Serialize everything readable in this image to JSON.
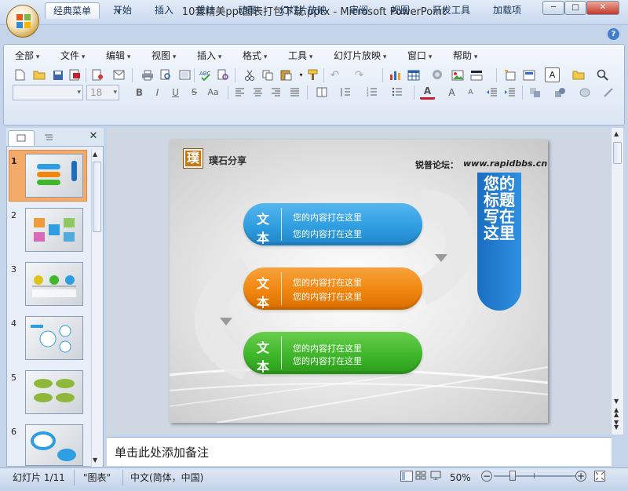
{
  "window": {
    "title": "10套精美ppt图表打包下载.pptx - Microsoft PowerPoint",
    "minimize": "─",
    "maximize": "□",
    "close": "✕"
  },
  "ribbon_tabs": [
    "经典菜单",
    "开始",
    "插入",
    "设计",
    "动画",
    "幻灯片放映",
    "审阅",
    "视图",
    "开发工具",
    "加载项"
  ],
  "menus": [
    "全部",
    "文件",
    "编辑",
    "视图",
    "插入",
    "格式",
    "工具",
    "幻灯片放映",
    "窗口",
    "帮助"
  ],
  "font_size_value": "18",
  "help_label": "?",
  "thumbnails": [
    "1",
    "2",
    "3",
    "4",
    "5",
    "6"
  ],
  "slide": {
    "logo_char": "璞",
    "brand": "璞石分享",
    "forum": "锐普论坛：",
    "forum_url": "www.rapidbbs.cn",
    "vertical_title": "您的标题写在这里",
    "bar_label_1": "文",
    "bar_label_2": "本",
    "bars": [
      {
        "line1": "您的内容打在这里",
        "line2": "您的内容打在这里",
        "color": "#2f9ee0"
      },
      {
        "line1": "您的内容打在这里",
        "line2": "您的内容打在这里",
        "color": "#f1860f"
      },
      {
        "line1": "您的内容打在这里",
        "line2": "您的内容打在这里",
        "color": "#3eb72a"
      }
    ]
  },
  "notes_placeholder": "单击此处添加备注",
  "status": {
    "slide_info": "幻灯片 1/11",
    "theme": "\"图表\"",
    "language": "中文(简体，中国)",
    "zoom": "50%"
  }
}
